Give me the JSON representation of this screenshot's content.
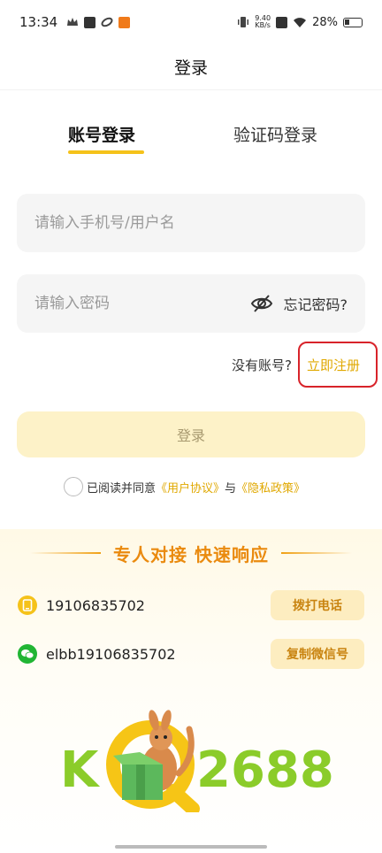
{
  "status_bar": {
    "time": "13:34",
    "speed_value": "9.40",
    "speed_unit": "KB/s",
    "battery": "28%"
  },
  "header": {
    "title": "登录"
  },
  "tabs": [
    {
      "label": "账号登录",
      "active": true
    },
    {
      "label": "验证码登录",
      "active": false
    }
  ],
  "form": {
    "phone_placeholder": "请输入手机号/用户名",
    "password_placeholder": "请输入密码",
    "forgot_label": "忘记密码?",
    "no_account_label": "没有账号?",
    "register_label": "立即注册",
    "login_label": "登录"
  },
  "agreement": {
    "prefix": "已阅读并同意",
    "user_agreement": "《用户协议》",
    "and": "与",
    "privacy_policy": "《隐私政策》"
  },
  "promo": {
    "title": "专人对接 快速响应",
    "phone": "19106835702",
    "call_label": "拨打电话",
    "wechat": "elbb19106835702",
    "copy_label": "复制微信号"
  },
  "logo": {
    "left_text": "K",
    "right_text": "2688"
  },
  "colors": {
    "accent": "#f5c21a",
    "link": "#e0a800",
    "promo_title": "#ea8a0e",
    "logo_green": "#8bcc2a",
    "highlight_red": "#d8232a"
  }
}
